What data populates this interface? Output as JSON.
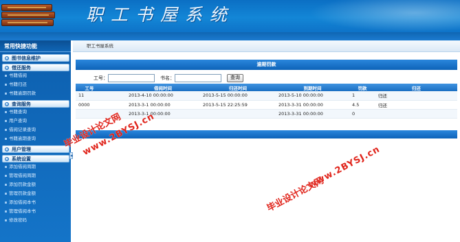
{
  "header": {
    "title": "职工书屋系统"
  },
  "sidebar": {
    "title": "常用快捷功能",
    "groups": [
      {
        "label": "图书信息维护",
        "items": []
      },
      {
        "label": "借还服务",
        "items": [
          "书籍借阅",
          "书籍归还",
          "书籍逾期罚款"
        ]
      },
      {
        "label": "查询服务",
        "items": [
          "书籍查询",
          "用户查询",
          "借阅记录查询",
          "书籍逾期查询"
        ]
      },
      {
        "label": "用户管理",
        "items": []
      },
      {
        "label": "系统设置",
        "items": [
          "添加借阅周期",
          "管理借阅周期",
          "添加罚款金额",
          "管理罚款金额",
          "添加借阅本书",
          "管理借阅本书",
          "修改密码"
        ]
      }
    ]
  },
  "breadcrumb": "职工书屋系统",
  "panel": {
    "title": "逾期罚款"
  },
  "search": {
    "id_label": "工号：",
    "id_value": "",
    "name_label": "书名：",
    "name_value": "",
    "button": "查询"
  },
  "table": {
    "headers": [
      "工号",
      "",
      "借阅时间",
      "归还时间",
      "到期时间",
      "罚款",
      "归还"
    ],
    "rows": [
      [
        "11",
        "",
        "2013-4-10 00:00:00",
        "2013-5-15 00:00:00",
        "2013-5-10 00:00:00",
        "1",
        "归还"
      ],
      [
        "0000",
        "",
        "2013-3-1 00:00:00",
        "2013-5-15 22:25:59",
        "2013-3-31 00:00:00",
        "4.5",
        "归还"
      ],
      [
        "",
        "",
        "2013-3-1 00:00:00",
        "",
        "2013-3-31 00:00:00",
        "0",
        ""
      ]
    ]
  },
  "watermarks": [
    "毕业设计论文网",
    "www.2BYSJ.cn",
    "毕业设计论文网",
    "www.2BYSJ.cn"
  ]
}
